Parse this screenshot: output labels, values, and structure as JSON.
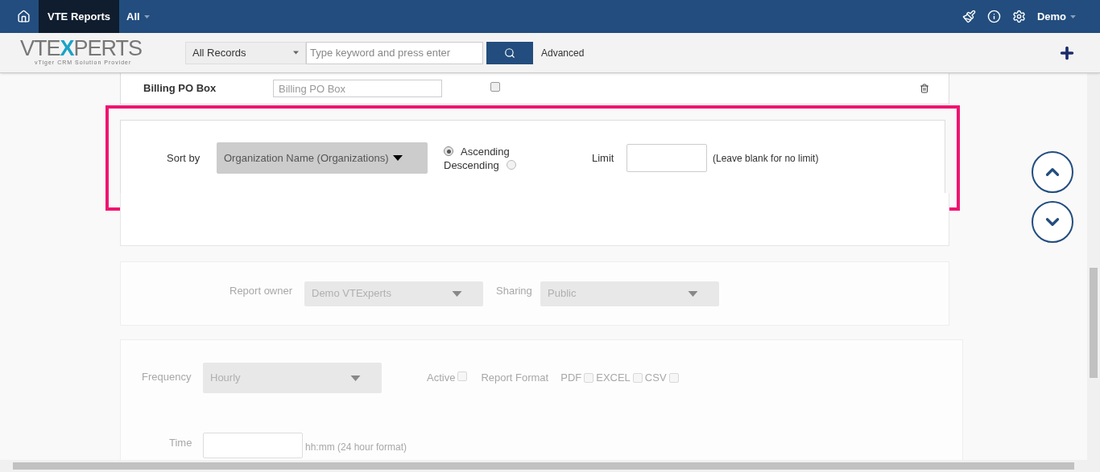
{
  "top_bar": {
    "app_title": "VTE Reports",
    "menu": "All",
    "user": "Demo"
  },
  "search_bar": {
    "logo": {
      "main": "VTE",
      "highlight": "X",
      "rest": "PERTS",
      "tagline": "vTiger  CRM Solution Provider"
    },
    "scope": "All Records",
    "placeholder": "Type keyword and press enter",
    "advanced_link": "Advanced"
  },
  "billing_row": {
    "label": "Billing PO Box",
    "placeholder": "Billing PO Box",
    "checked": false
  },
  "sort_section": {
    "highlighted": true,
    "label": "Sort by",
    "field": "Organization Name (Organizations)",
    "order_options": [
      {
        "label": "Ascending",
        "selected": true
      },
      {
        "label": "Descending",
        "selected": false
      }
    ],
    "limit_label": "Limit",
    "limit_hint": "(Leave blank for no limit)"
  },
  "sharing_section": {
    "disabled": true,
    "owner_label": "Report owner",
    "owner": "Demo VTExperts",
    "sharing_label": "Sharing",
    "sharing": "Public"
  },
  "schedule_section": {
    "disabled": true,
    "frequency_label": "Frequency",
    "frequency": "Hourly",
    "active": {
      "label": "Active",
      "checked": false
    },
    "format_label": "Report Format",
    "formats": [
      {
        "label": "PDF",
        "checked": false
      },
      {
        "label": "EXCEL",
        "checked": false
      },
      {
        "label": "CSV",
        "checked": false
      }
    ],
    "time_label": "Time",
    "time_hint": "hh:mm (24 hour format)"
  }
}
